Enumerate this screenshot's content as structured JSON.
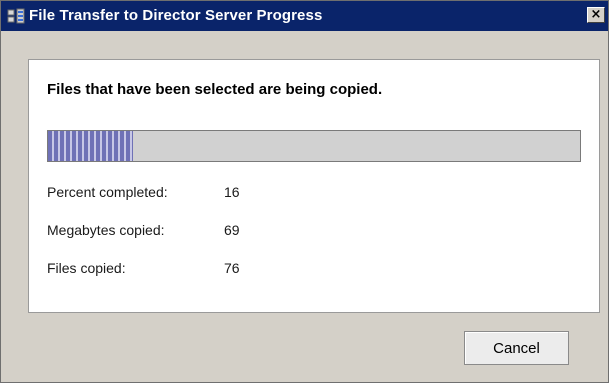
{
  "window": {
    "title": "File Transfer to Director Server Progress",
    "title_icon": "app-transfer-icon",
    "close_label": "×"
  },
  "panel": {
    "message": "Files that have been selected are being copied."
  },
  "progress": {
    "percent": 16,
    "fill_color": "#6f71b6"
  },
  "stats": [
    {
      "label": "Percent completed:",
      "value": "16"
    },
    {
      "label": "Megabytes copied:",
      "value": "69"
    },
    {
      "label": "Files copied:",
      "value": "76"
    }
  ],
  "buttons": {
    "cancel_label": "Cancel"
  },
  "colors": {
    "titlebar": "#0a246a",
    "window_bg": "#d4d0c8",
    "panel_bg": "#ffffff"
  }
}
